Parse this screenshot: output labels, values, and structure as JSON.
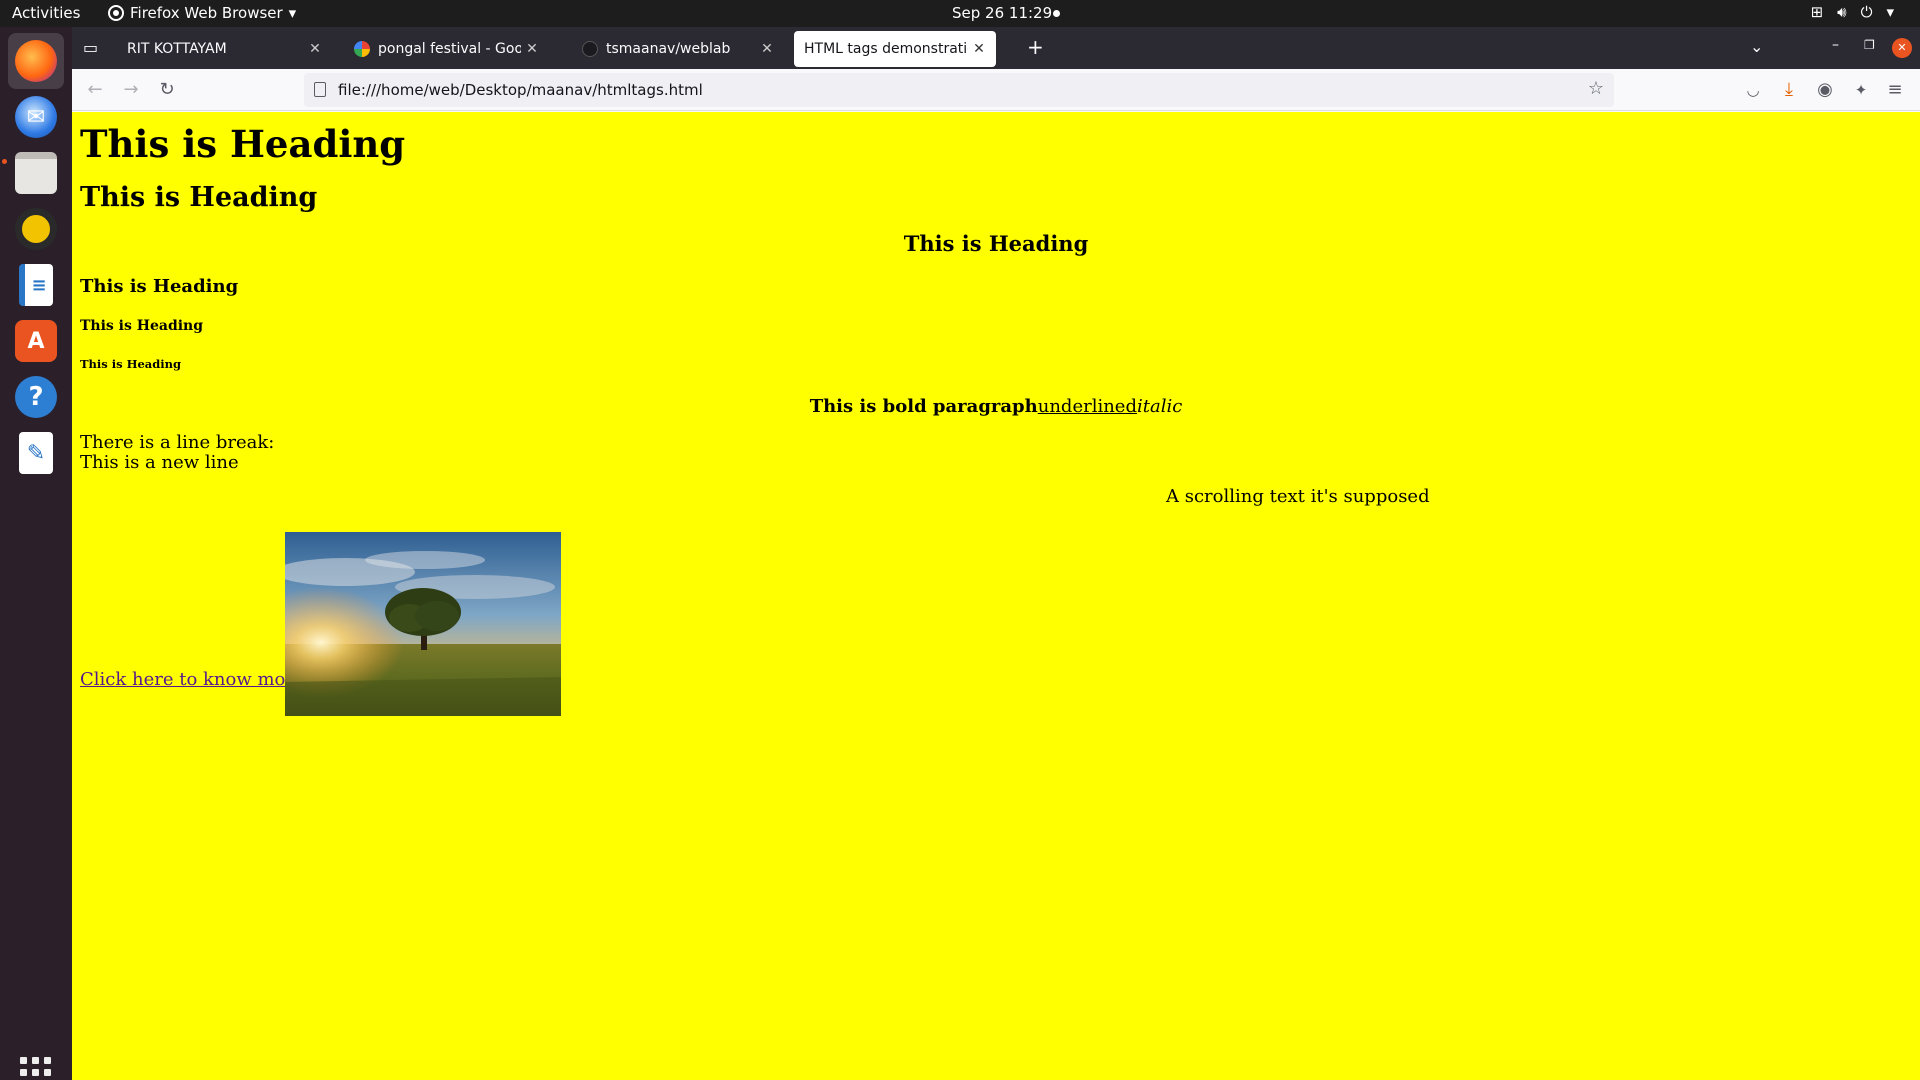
{
  "topbar": {
    "activities": "Activities",
    "app_name": "Firefox Web Browser",
    "clock": "Sep 26  11:29",
    "icons": [
      "network-icon",
      "volume-icon",
      "power-icon"
    ]
  },
  "dock": {
    "items": [
      "firefox-icon",
      "thunderbird-icon",
      "files-icon",
      "rhythmbox-icon",
      "writer-icon",
      "software-icon",
      "help-icon",
      "text-editor-icon"
    ],
    "show_apps": "show-apps-icon"
  },
  "browser": {
    "tabs": [
      {
        "label": "RIT KOTTAYAM",
        "selected": false
      },
      {
        "label": "pongal festival - Google S",
        "selected": false
      },
      {
        "label": "tsmaanav/weblab",
        "selected": false
      },
      {
        "label": "HTML tags demonstration",
        "selected": true
      }
    ],
    "new_tab": "+",
    "url": "file:///home/web/Desktop/maanav/htmltags.html"
  },
  "page": {
    "background": "#ffff00",
    "h1": "This is Heading",
    "h2": "This is Heading",
    "h3": "This is Heading",
    "h4": "This is Heading",
    "h5": "This is Heading",
    "h6": "This is Heading",
    "bold_text": "This is bold paragraph",
    "underlined_text": "underlined",
    "italic_text": "italic",
    "line_break_1": "There is a line break:",
    "line_break_2": "This is a new line",
    "marquee_text": "A scrolling text it's supposed",
    "link_text": "Click here to know more",
    "image_subject": "sunset-tree-field-photo"
  }
}
